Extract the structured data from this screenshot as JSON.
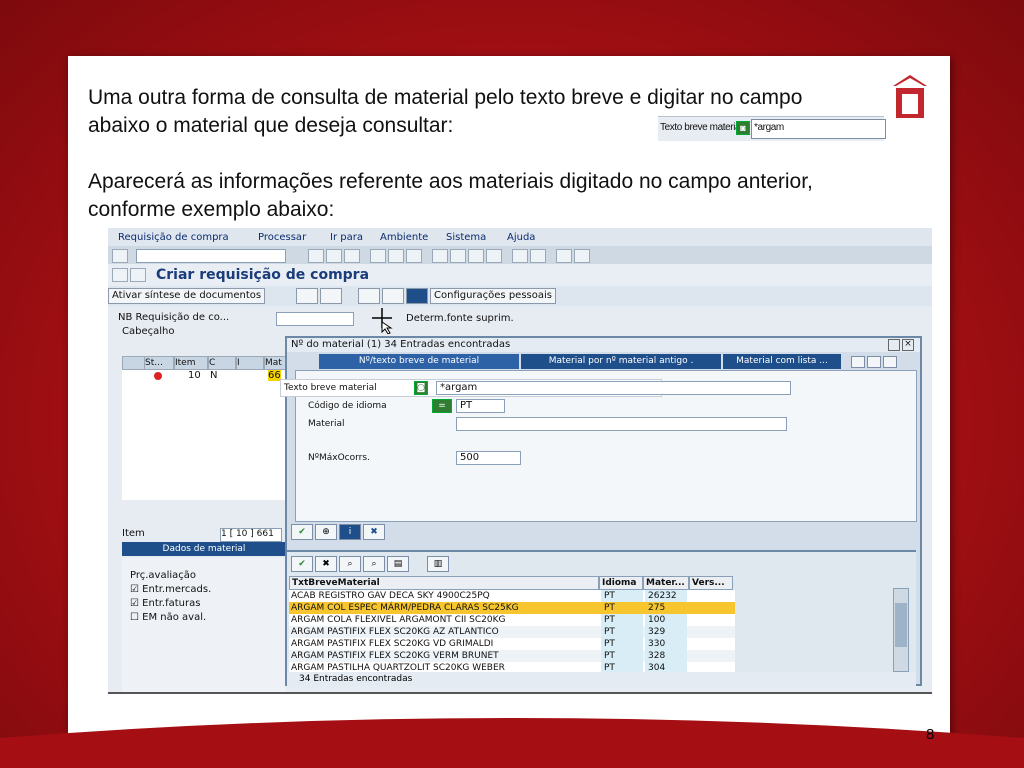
{
  "slide": {
    "paragraph1": "Uma outra forma de consulta de material pelo texto breve e digitar no campo abaixo o material que deseja consultar:",
    "paragraph2": "Aparecerá as informações referente aos materiais digitado no campo anterior, conforme exemplo abaixo:",
    "inline_label": "Texto breve material",
    "inline_value": "*argam",
    "page_number": "8"
  },
  "sap": {
    "menu": [
      "Requisição de compra",
      "Processar",
      "Ir para",
      "Ambiente",
      "Sistema",
      "Ajuda"
    ],
    "title": "Criar requisição de compra",
    "app_buttons": {
      "activate": "Ativar síntese de documentos",
      "personal": "Configurações pessoais"
    },
    "doc_type": "NB Requisição de co...",
    "determ": "Determ.fonte suprim.",
    "header_label": "Cabeçalho",
    "grid_headers": [
      "St...",
      "Item",
      "C",
      "I",
      "Mat"
    ],
    "grid_row": {
      "item": "10",
      "c": "N",
      "mat": "66"
    },
    "item_label": "Item",
    "item_value": "1 [ 10 ] 661",
    "dados_tab": "Dados de material",
    "lower": {
      "prc": "Prç.avaliação",
      "entr_merc": "Entr.mercads.",
      "entr_fat": "Entr.faturas",
      "em_nao": "EM não aval."
    },
    "popup": {
      "title": "Nº do material (1)   34 Entradas encontradas",
      "tabs": [
        "Nº/texto breve de material",
        "Material por nº material antigo .",
        "Material com lista ..."
      ],
      "fields": {
        "texto_label": "Texto breve material",
        "texto_value": "*argam",
        "idioma_label": "Código de idioma",
        "idioma_value": "PT",
        "material_label": "Material",
        "max_label": "NºMáxOcorrs.",
        "max_value": "500"
      },
      "results_headers": [
        "TxtBreveMaterial",
        "Idioma",
        "Mater...",
        "Vers..."
      ],
      "results": [
        {
          "text": "ACAB REGISTRO GAV DECA SKY 4900C25PQ",
          "lang": "PT",
          "mat": "26232",
          "sel": false
        },
        {
          "text": "ARGAM COL ESPEC MÁRM/PEDRA CLARAS SC25KG",
          "lang": "PT",
          "mat": "275",
          "sel": true
        },
        {
          "text": "ARGAM COLA FLEXIVEL ARGAMONT CII SC20KG",
          "lang": "PT",
          "mat": "100",
          "sel": false
        },
        {
          "text": "ARGAM PASTIFIX FLEX  SC20KG AZ ATLANTICO",
          "lang": "PT",
          "mat": "329",
          "sel": false
        },
        {
          "text": "ARGAM PASTIFIX FLEX  SC20KG VD GRIMALDI",
          "lang": "PT",
          "mat": "330",
          "sel": false
        },
        {
          "text": "ARGAM PASTIFIX FLEX SC20KG VERM BRUNET",
          "lang": "PT",
          "mat": "328",
          "sel": false
        },
        {
          "text": "ARGAM PASTILHA QUARTZOLIT SC20KG WEBER",
          "lang": "PT",
          "mat": "304",
          "sel": false
        }
      ],
      "status": "34 Entradas encontradas"
    }
  }
}
